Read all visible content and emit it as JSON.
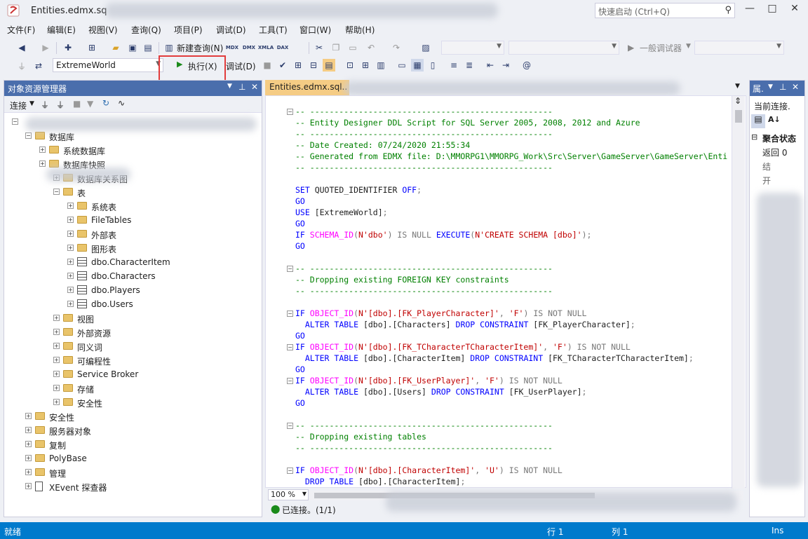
{
  "window": {
    "title": "Entities.edmx.sq",
    "quick_launch_placeholder": "快速启动 (Ctrl+Q)",
    "minimize": "—",
    "maximize": "□",
    "close": "✕"
  },
  "menu": [
    "文件(F)",
    "编辑(E)",
    "视图(V)",
    "查询(Q)",
    "项目(P)",
    "调试(D)",
    "工具(T)",
    "窗口(W)",
    "帮助(H)"
  ],
  "toolbar1": {
    "new_query": "新建查询(N)",
    "icons": [
      "MDX",
      "DMX",
      "XMLA",
      "DAX"
    ],
    "debugger_combo": "一般调试器"
  },
  "toolbar2": {
    "database": "ExtremeWorld",
    "execute": "执行(X)",
    "debug": "调试(D)"
  },
  "object_explorer": {
    "title": "对象资源管理器",
    "connect": "连接",
    "tree": [
      {
        "label": "数据库",
        "icon": "folder",
        "level": 1,
        "expanded": true
      },
      {
        "label": "系统数据库",
        "icon": "folder",
        "level": 2
      },
      {
        "label": "数据库快照",
        "icon": "folder",
        "level": 2
      },
      {
        "label": "数据库关系图",
        "icon": "folder",
        "level": 3
      },
      {
        "label": "表",
        "icon": "folder",
        "level": 3,
        "expanded": true
      },
      {
        "label": "系统表",
        "icon": "folder",
        "level": 4
      },
      {
        "label": "FileTables",
        "icon": "folder",
        "level": 4
      },
      {
        "label": "外部表",
        "icon": "folder",
        "level": 4
      },
      {
        "label": "图形表",
        "icon": "folder",
        "level": 4
      },
      {
        "label": "dbo.CharacterItem",
        "icon": "table",
        "level": 4
      },
      {
        "label": "dbo.Characters",
        "icon": "table",
        "level": 4
      },
      {
        "label": "dbo.Players",
        "icon": "table",
        "level": 4
      },
      {
        "label": "dbo.Users",
        "icon": "table",
        "level": 4
      },
      {
        "label": "视图",
        "icon": "folder",
        "level": 3
      },
      {
        "label": "外部资源",
        "icon": "folder",
        "level": 3
      },
      {
        "label": "同义词",
        "icon": "folder",
        "level": 3
      },
      {
        "label": "可编程性",
        "icon": "folder",
        "level": 3
      },
      {
        "label": "Service Broker",
        "icon": "folder",
        "level": 3
      },
      {
        "label": "存储",
        "icon": "folder",
        "level": 3
      },
      {
        "label": "安全性",
        "icon": "folder",
        "level": 3
      },
      {
        "label": "安全性",
        "icon": "folder",
        "level": 1
      },
      {
        "label": "服务器对象",
        "icon": "folder",
        "level": 1
      },
      {
        "label": "复制",
        "icon": "folder",
        "level": 1
      },
      {
        "label": "PolyBase",
        "icon": "folder",
        "level": 1
      },
      {
        "label": "管理",
        "icon": "folder",
        "level": 1
      },
      {
        "label": "XEvent 探查器",
        "icon": "xevent",
        "level": 1
      }
    ]
  },
  "editor": {
    "tab": "Entities.edmx.sql..",
    "zoom": "100 %",
    "status": "已连接。(1/1)",
    "lines": [
      {
        "y": 0,
        "segs": [
          [
            "c-cmt",
            "-- --------------------------------------------------"
          ]
        ],
        "fold": true
      },
      {
        "y": 1,
        "segs": [
          [
            "c-cmt",
            "-- Entity Designer DDL Script for SQL Server 2005, 2008, 2012 and Azure"
          ]
        ]
      },
      {
        "y": 2,
        "segs": [
          [
            "c-cmt",
            "-- --------------------------------------------------"
          ]
        ]
      },
      {
        "y": 3,
        "segs": [
          [
            "c-cmt",
            "-- Date Created: 07/24/2020 21:55:34"
          ]
        ]
      },
      {
        "y": 4,
        "segs": [
          [
            "c-cmt",
            "-- Generated from EDMX file: D:\\MMORPG1\\MMORPG_Work\\Src\\Server\\GameServer\\GameServer\\Enti"
          ]
        ]
      },
      {
        "y": 5,
        "segs": [
          [
            "c-cmt",
            "-- --------------------------------------------------"
          ]
        ]
      },
      {
        "y": 7,
        "segs": [
          [
            "c-kw",
            "SET "
          ],
          [
            "c-txt",
            "QUOTED_IDENTIFIER "
          ],
          [
            "c-kw",
            "OFF"
          ],
          [
            "c-op",
            ";"
          ]
        ]
      },
      {
        "y": 8,
        "segs": [
          [
            "c-kw",
            "GO"
          ]
        ]
      },
      {
        "y": 9,
        "segs": [
          [
            "c-kw",
            "USE "
          ],
          [
            "c-txt",
            "[ExtremeWorld]"
          ],
          [
            "c-op",
            ";"
          ]
        ]
      },
      {
        "y": 10,
        "segs": [
          [
            "c-kw",
            "GO"
          ]
        ]
      },
      {
        "y": 11,
        "segs": [
          [
            "c-kw",
            "IF "
          ],
          [
            "c-fn",
            "SCHEMA_ID"
          ],
          [
            "c-op",
            "("
          ],
          [
            "c-str",
            "N'dbo'"
          ],
          [
            "c-op",
            ") IS NULL "
          ],
          [
            "c-kw",
            "EXECUTE"
          ],
          [
            "c-op",
            "("
          ],
          [
            "c-str",
            "N'CREATE SCHEMA [dbo]'"
          ],
          [
            "c-op",
            ");"
          ]
        ]
      },
      {
        "y": 12,
        "segs": [
          [
            "c-kw",
            "GO"
          ]
        ]
      },
      {
        "y": 14,
        "segs": [
          [
            "c-cmt",
            "-- --------------------------------------------------"
          ]
        ],
        "fold": true
      },
      {
        "y": 15,
        "segs": [
          [
            "c-cmt",
            "-- Dropping existing FOREIGN KEY constraints"
          ]
        ]
      },
      {
        "y": 16,
        "segs": [
          [
            "c-cmt",
            "-- --------------------------------------------------"
          ]
        ]
      },
      {
        "y": 18,
        "segs": [
          [
            "c-kw",
            "IF "
          ],
          [
            "c-fn",
            "OBJECT_ID"
          ],
          [
            "c-op",
            "("
          ],
          [
            "c-str",
            "N'[dbo].[FK_PlayerCharacter]'"
          ],
          [
            "c-op",
            ", "
          ],
          [
            "c-str",
            "'F'"
          ],
          [
            "c-op",
            ") IS NOT NULL"
          ]
        ],
        "fold": true
      },
      {
        "y": 19,
        "segs": [
          [
            "c-txt",
            "  "
          ],
          [
            "c-kw",
            "ALTER TABLE "
          ],
          [
            "c-txt",
            "[dbo].[Characters] "
          ],
          [
            "c-kw",
            "DROP CONSTRAINT "
          ],
          [
            "c-txt",
            "[FK_PlayerCharacter]"
          ],
          [
            "c-op",
            ";"
          ]
        ]
      },
      {
        "y": 20,
        "segs": [
          [
            "c-kw",
            "GO"
          ]
        ]
      },
      {
        "y": 21,
        "segs": [
          [
            "c-kw",
            "IF "
          ],
          [
            "c-fn",
            "OBJECT_ID"
          ],
          [
            "c-op",
            "("
          ],
          [
            "c-str",
            "N'[dbo].[FK_TCharacterTCharacterItem]'"
          ],
          [
            "c-op",
            ", "
          ],
          [
            "c-str",
            "'F'"
          ],
          [
            "c-op",
            ") IS NOT NULL"
          ]
        ],
        "fold": true
      },
      {
        "y": 22,
        "segs": [
          [
            "c-txt",
            "  "
          ],
          [
            "c-kw",
            "ALTER TABLE "
          ],
          [
            "c-txt",
            "[dbo].[CharacterItem] "
          ],
          [
            "c-kw",
            "DROP CONSTRAINT "
          ],
          [
            "c-txt",
            "[FK_TCharacterTCharacterItem]"
          ],
          [
            "c-op",
            ";"
          ]
        ]
      },
      {
        "y": 23,
        "segs": [
          [
            "c-kw",
            "GO"
          ]
        ]
      },
      {
        "y": 24,
        "segs": [
          [
            "c-kw",
            "IF "
          ],
          [
            "c-fn",
            "OBJECT_ID"
          ],
          [
            "c-op",
            "("
          ],
          [
            "c-str",
            "N'[dbo].[FK_UserPlayer]'"
          ],
          [
            "c-op",
            ", "
          ],
          [
            "c-str",
            "'F'"
          ],
          [
            "c-op",
            ") IS NOT NULL"
          ]
        ],
        "fold": true
      },
      {
        "y": 25,
        "segs": [
          [
            "c-txt",
            "  "
          ],
          [
            "c-kw",
            "ALTER TABLE "
          ],
          [
            "c-txt",
            "[dbo].[Users] "
          ],
          [
            "c-kw",
            "DROP CONSTRAINT "
          ],
          [
            "c-txt",
            "[FK_UserPlayer]"
          ],
          [
            "c-op",
            ";"
          ]
        ]
      },
      {
        "y": 26,
        "segs": [
          [
            "c-kw",
            "GO"
          ]
        ]
      },
      {
        "y": 28,
        "segs": [
          [
            "c-cmt",
            "-- --------------------------------------------------"
          ]
        ],
        "fold": true
      },
      {
        "y": 29,
        "segs": [
          [
            "c-cmt",
            "-- Dropping existing tables"
          ]
        ]
      },
      {
        "y": 30,
        "segs": [
          [
            "c-cmt",
            "-- --------------------------------------------------"
          ]
        ]
      },
      {
        "y": 32,
        "segs": [
          [
            "c-kw",
            "IF "
          ],
          [
            "c-fn",
            "OBJECT_ID"
          ],
          [
            "c-op",
            "("
          ],
          [
            "c-str",
            "N'[dbo].[CharacterItem]'"
          ],
          [
            "c-op",
            ", "
          ],
          [
            "c-str",
            "'U'"
          ],
          [
            "c-op",
            ") IS NOT NULL"
          ]
        ],
        "fold": true
      },
      {
        "y": 33,
        "segs": [
          [
            "c-txt",
            "  "
          ],
          [
            "c-kw",
            "DROP TABLE "
          ],
          [
            "c-txt",
            "[dbo].[CharacterItem]"
          ],
          [
            "c-op",
            ";"
          ]
        ]
      }
    ]
  },
  "properties": {
    "title": "属.",
    "current_connection": "当前连接.",
    "section": "聚合状态",
    "rows": [
      "返回 0",
      "结",
      "开"
    ]
  },
  "status": {
    "ready": "就绪",
    "row": "行 1",
    "col": "列 1",
    "ins": "Ins"
  },
  "colors": {
    "accent": "#007acc",
    "panel_header": "#4a6eac",
    "tab_active": "#f5cc84",
    "highlight_box": "#e23c3c"
  }
}
